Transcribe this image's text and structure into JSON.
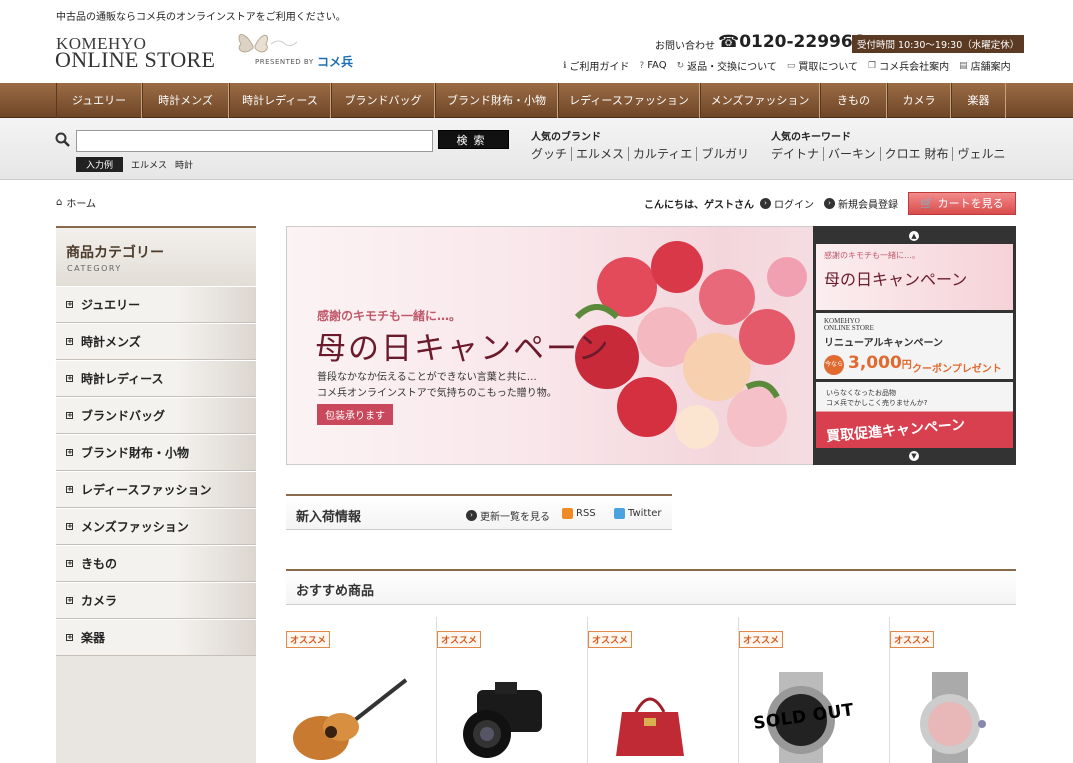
{
  "header": {
    "tagline": "中古品の通販ならコメ兵のオンラインストアをご利用ください。",
    "logo_line1": "KOMEHYO",
    "logo_line2": "ONLINE STORE",
    "presented_by": "PRESENTED BY",
    "brand": "コメ兵",
    "contact_label": "お問い合わせ",
    "phone": "0120-229966",
    "hours": "受付時間 10:30〜19:30（水曜定休）",
    "links": [
      {
        "icon": "info-icon",
        "label": "ご利用ガイド"
      },
      {
        "icon": "question-icon",
        "label": "FAQ"
      },
      {
        "icon": "return-icon",
        "label": "返品・交換について"
      },
      {
        "icon": "buy-icon",
        "label": "買取について"
      },
      {
        "icon": "company-icon",
        "label": "コメ兵会社案内"
      },
      {
        "icon": "shop-icon",
        "label": "店舗案内"
      }
    ]
  },
  "nav": [
    {
      "label": "ジュエリー"
    },
    {
      "label": "時計メンズ"
    },
    {
      "label": "時計レディース"
    },
    {
      "label": "ブランドバッグ"
    },
    {
      "label": "ブランド財布・小物"
    },
    {
      "label": "レディースファッション"
    },
    {
      "label": "メンズファッション"
    },
    {
      "label": "きもの"
    },
    {
      "label": "カメラ"
    },
    {
      "label": "楽器"
    }
  ],
  "search": {
    "value": "",
    "button": "検索",
    "example_label": "入力例",
    "examples": [
      "エルメス",
      "時計"
    ],
    "brands_heading": "人気のブランド",
    "brands": [
      "グッチ",
      "エルメス",
      "カルティエ",
      "ブルガリ"
    ],
    "keywords_heading": "人気のキーワード",
    "keywords": [
      "デイトナ",
      "バーキン",
      "クロエ 財布",
      "ヴェルニ"
    ]
  },
  "breadcrumb": {
    "home": "ホーム"
  },
  "user": {
    "greeting": "こんにちは、ゲストさん",
    "login": "ログイン",
    "register": "新規会員登録",
    "cart": "カートを見る"
  },
  "category": {
    "title": "商品カテゴリー",
    "subtitle": "CATEGORY",
    "items": [
      {
        "label": "ジュエリー"
      },
      {
        "label": "時計メンズ"
      },
      {
        "label": "時計レディース"
      },
      {
        "label": "ブランドバッグ"
      },
      {
        "label": "ブランド財布・小物"
      },
      {
        "label": "レディースファッション"
      },
      {
        "label": "メンズファッション"
      },
      {
        "label": "きもの"
      },
      {
        "label": "カメラ"
      },
      {
        "label": "楽器"
      }
    ]
  },
  "banner": {
    "sub": "感謝のキモチも一緒に…。",
    "title": "母の日キャンペーン",
    "text1": "普段なかなか伝えることができない言葉と共に…",
    "text2": "コメ兵オンラインストアで気持ちのこもった贈り物。",
    "button": "包装承ります"
  },
  "thumbs": {
    "t1_sub": "感謝のキモチも一緒に…。",
    "t1_title": "母の日キャンペーン",
    "t2_logo1": "KOMEHYO",
    "t2_logo2": "ONLINE STORE",
    "t2_title": "リニューアルキャンペーン",
    "t2_badge": "今なら",
    "t2_amount": "3,000",
    "t2_unit": "円",
    "t2_coupon": "クーポンプレゼント",
    "t3_line1": "いらなくなったお品物",
    "t3_line2": "コメ兵でかしこく売りませんか?",
    "t3_title": "買取促進キャンペーン"
  },
  "new_arrivals": {
    "title": "新入荷情報",
    "more": "更新一覧を見る",
    "rss": "RSS",
    "twitter": "Twitter"
  },
  "recommended": {
    "title": "おすすめ商品",
    "badge": "オススメ",
    "sold_out": "SOLD OUT"
  }
}
